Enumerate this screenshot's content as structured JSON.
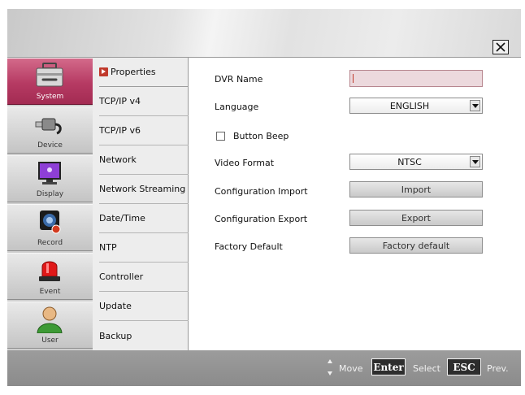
{
  "header": {
    "close_label": "X"
  },
  "rail": {
    "items": [
      {
        "label": "System",
        "icon": "toolbox-icon",
        "active": true
      },
      {
        "label": "Device",
        "icon": "usb-plug-icon",
        "active": false
      },
      {
        "label": "Display",
        "icon": "monitor-icon",
        "active": false
      },
      {
        "label": "Record",
        "icon": "camera-icon",
        "active": false
      },
      {
        "label": "Event",
        "icon": "alarm-siren-icon",
        "active": false
      },
      {
        "label": "User",
        "icon": "user-icon",
        "active": false
      }
    ]
  },
  "submenu": {
    "items": [
      {
        "label": "Properties",
        "active": true
      },
      {
        "label": "TCP/IP v4",
        "active": false
      },
      {
        "label": "TCP/IP v6",
        "active": false
      },
      {
        "label": "Network",
        "active": false
      },
      {
        "label": "Network Streaming",
        "active": false
      },
      {
        "label": "Date/Time",
        "active": false
      },
      {
        "label": "NTP",
        "active": false
      },
      {
        "label": "Controller",
        "active": false
      },
      {
        "label": "Update",
        "active": false
      },
      {
        "label": "Backup",
        "active": false
      }
    ]
  },
  "form": {
    "dvr_name": {
      "label": "DVR Name",
      "value": ""
    },
    "language": {
      "label": "Language",
      "value": "ENGLISH"
    },
    "button_beep": {
      "label": "Button Beep",
      "checked": false
    },
    "video_format": {
      "label": "Video Format",
      "value": "NTSC"
    },
    "config_import": {
      "label": "Configuration Import",
      "button": "Import"
    },
    "config_export": {
      "label": "Configuration Export",
      "button": "Export"
    },
    "factory_default": {
      "label": "Factory Default",
      "button": "Factory default"
    }
  },
  "footer": {
    "move_label": "Move",
    "enter_key": "Enter",
    "select_label": "Select",
    "esc_key": "ESC",
    "prev_label": "Prev."
  },
  "colors": {
    "accent": "#b63a63",
    "arrow": "#c0392b",
    "footer_bg": "#8f8f8f"
  }
}
